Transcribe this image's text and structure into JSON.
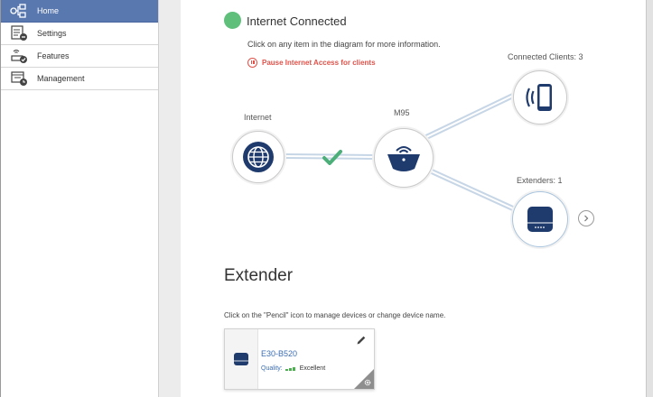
{
  "sidebar": {
    "items": [
      {
        "label": "Home",
        "icon": "network-icon",
        "active": true
      },
      {
        "label": "Settings",
        "icon": "settings-icon",
        "active": false
      },
      {
        "label": "Features",
        "icon": "features-icon",
        "active": false
      },
      {
        "label": "Management",
        "icon": "management-icon",
        "active": false
      }
    ]
  },
  "status": {
    "text": "Internet Connected",
    "color": "#5fbf7b",
    "info": "Click on any item in the diagram for more information.",
    "pause_label": "Pause Internet Access for clients"
  },
  "diagram": {
    "internet_label": "Internet",
    "router_label": "M95",
    "clients_label": "Connected Clients: 3",
    "extenders_label": "Extenders: 1",
    "check_color": "#4caf7a",
    "accent": "#1f3b6e"
  },
  "extender": {
    "heading": "Extender",
    "info": "Click on the \"Pencil\" icon to manage devices or change device name.",
    "device": {
      "name": "E30-B520",
      "quality_label": "Quality:",
      "quality_value": "Excellent"
    }
  }
}
